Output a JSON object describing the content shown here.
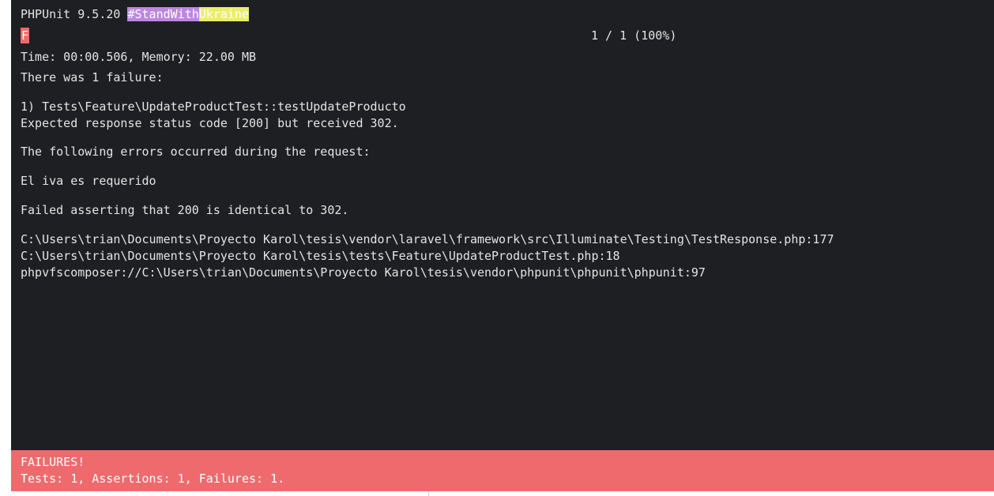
{
  "header": {
    "version": "PHPUnit 9.5.20 ",
    "tag_part1": "#StandWith",
    "tag_part2": "Ukraine"
  },
  "progress": {
    "status_char": "F",
    "counter": "1 / 1 (100%)"
  },
  "summary": {
    "time_memory": "Time: 00:00.506, Memory: 22.00 MB",
    "failure_count": "There was 1 failure:"
  },
  "failure": {
    "title": "1) Tests\\Feature\\UpdateProductTest::testUpdateProducto",
    "message": "Expected response status code [200] but received 302.",
    "errors_heading": "The following errors occurred during the request:",
    "error_detail": "El iva es requerido",
    "assertion": "Failed asserting that 200 is identical to 302.",
    "trace": [
      "C:\\Users\\trian\\Documents\\Proyecto Karol\\tesis\\vendor\\laravel\\framework\\src\\Illuminate\\Testing\\TestResponse.php:177",
      "C:\\Users\\trian\\Documents\\Proyecto Karol\\tesis\\tests\\Feature\\UpdateProductTest.php:18",
      "phpvfscomposer://C:\\Users\\trian\\Documents\\Proyecto Karol\\tesis\\vendor\\phpunit\\phpunit\\phpunit:97"
    ]
  },
  "result": {
    "label": "FAILURES!",
    "stats": "Tests: 1, Assertions: 1, Failures: 1."
  },
  "colors": {
    "background": "#1e1f22",
    "text": "#e4e4e4",
    "failure": "#ef6a6d",
    "ukraine_blue_tag": "#bd86e3",
    "ukraine_yellow_tag": "#e9ee6a"
  }
}
